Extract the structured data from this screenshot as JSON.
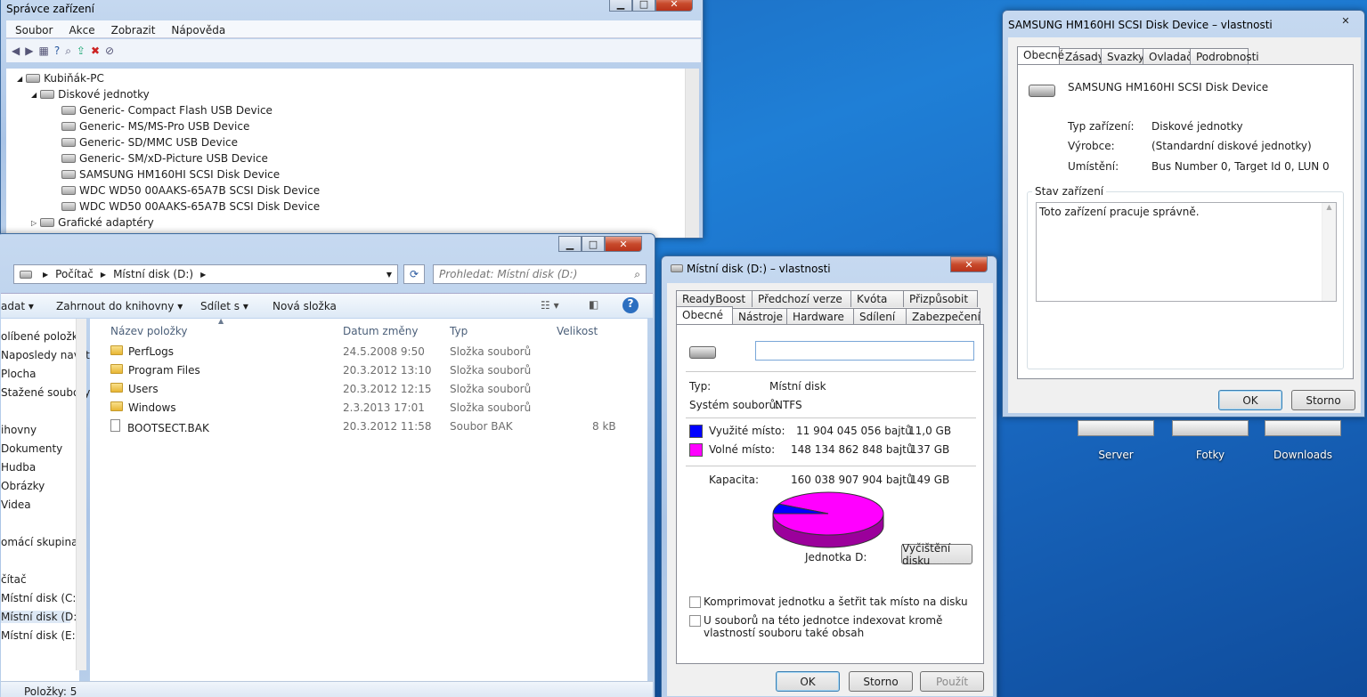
{
  "devmgr": {
    "title": "Správce zařízení",
    "menu": [
      "Soubor",
      "Akce",
      "Zobrazit",
      "Nápověda"
    ],
    "tree": [
      "Kubiňák-PC",
      "Diskové jednotky",
      "Generic- Compact Flash USB Device",
      "Generic- MS/MS-Pro USB Device",
      "Generic- SD/MMC USB Device",
      "Generic- SM/xD-Picture USB Device",
      "SAMSUNG HM160HI SCSI Disk Device",
      "WDC WD50 00AAKS-65A7B SCSI Disk Device",
      "WDC WD50 00AAKS-65A7B SCSI Disk Device",
      "Grafické adaptéry"
    ]
  },
  "explorer": {
    "breadcrumb": [
      "Počítač",
      "Místní disk (D:)"
    ],
    "search_placeholder": "Prohledat: Místní disk (D:)",
    "toolbar": [
      "adat",
      "Zahrnout do knihovny",
      "Sdílet s",
      "Nová složka"
    ],
    "columns": [
      "Název položky",
      "Datum změny",
      "Typ",
      "Velikost"
    ],
    "rows": [
      {
        "name": "PerfLogs",
        "date": "24.5.2008 9:50",
        "type": "Složka souborů",
        "size": ""
      },
      {
        "name": "Program Files",
        "date": "20.3.2012 13:10",
        "type": "Složka souborů",
        "size": ""
      },
      {
        "name": "Users",
        "date": "20.3.2012 12:15",
        "type": "Složka souborů",
        "size": ""
      },
      {
        "name": "Windows",
        "date": "2.3.2013 17:01",
        "type": "Složka souborů",
        "size": ""
      },
      {
        "name": "BOOTSECT.BAK",
        "date": "20.3.2012 11:58",
        "type": "Soubor BAK",
        "size": "8 kB"
      }
    ],
    "nav": [
      "olíbené položky",
      "Naposledy navšti",
      "Plocha",
      "Stažené soubory",
      "ihovny",
      "Dokumenty",
      "Hudba",
      "Obrázky",
      "Videa",
      "omácí skupina",
      "čítač",
      "Místní disk (C:)",
      "Místní disk (D:)",
      "Místní disk (E:)"
    ],
    "status": "Položky: 5"
  },
  "diskprops": {
    "title": "Místní disk (D:) – vlastnosti",
    "tabs_top": [
      "ReadyBoost",
      "Předchozí verze",
      "Kvóta",
      "Přizpůsobit"
    ],
    "tabs_bottom": [
      "Obecné",
      "Nástroje",
      "Hardware",
      "Sdílení",
      "Zabezpečení"
    ],
    "type_label": "Typ:",
    "type_value": "Místní disk",
    "fs_label": "Systém souborů:",
    "fs_value": "NTFS",
    "used_label": "Využité místo:",
    "used_bytes": "11 904 045 056 bajtů",
    "used_gb": "11,0 GB",
    "free_label": "Volné místo:",
    "free_bytes": "148 134 862 848 bajtů",
    "free_gb": "137 GB",
    "cap_label": "Kapacita:",
    "cap_bytes": "160 038 907 904 bajtů",
    "cap_gb": "149 GB",
    "drive_label": "Jednotka D:",
    "cleanup": "Vyčištění disku",
    "compress": "Komprimovat jednotku a šetřit tak místo na disku",
    "index": "U souborů na této jednotce indexovat kromě vlastností souboru také obsah",
    "ok": "OK",
    "cancel": "Storno",
    "apply": "Použít",
    "used_color": "#0000ff",
    "free_color": "#ff00ff",
    "used_fraction": 0.0744
  },
  "devprops": {
    "title": "SAMSUNG HM160HI SCSI Disk Device – vlastnosti",
    "tabs": [
      "Obecné",
      "Zásady",
      "Svazky",
      "Ovladač",
      "Podrobnosti"
    ],
    "device": "SAMSUNG HM160HI SCSI Disk Device",
    "type_label": "Typ zařízení:",
    "type_value": "Diskové jednotky",
    "mfr_label": "Výrobce:",
    "mfr_value": "(Standardní diskové jednotky)",
    "loc_label": "Umístění:",
    "loc_value": "Bus Number 0, Target Id 0, LUN 0",
    "status_group": "Stav zařízení",
    "status_text": "Toto zařízení pracuje správně.",
    "ok": "OK",
    "cancel": "Storno"
  },
  "desktop": {
    "icons": [
      "Server",
      "Fotky",
      "Downloads"
    ]
  }
}
